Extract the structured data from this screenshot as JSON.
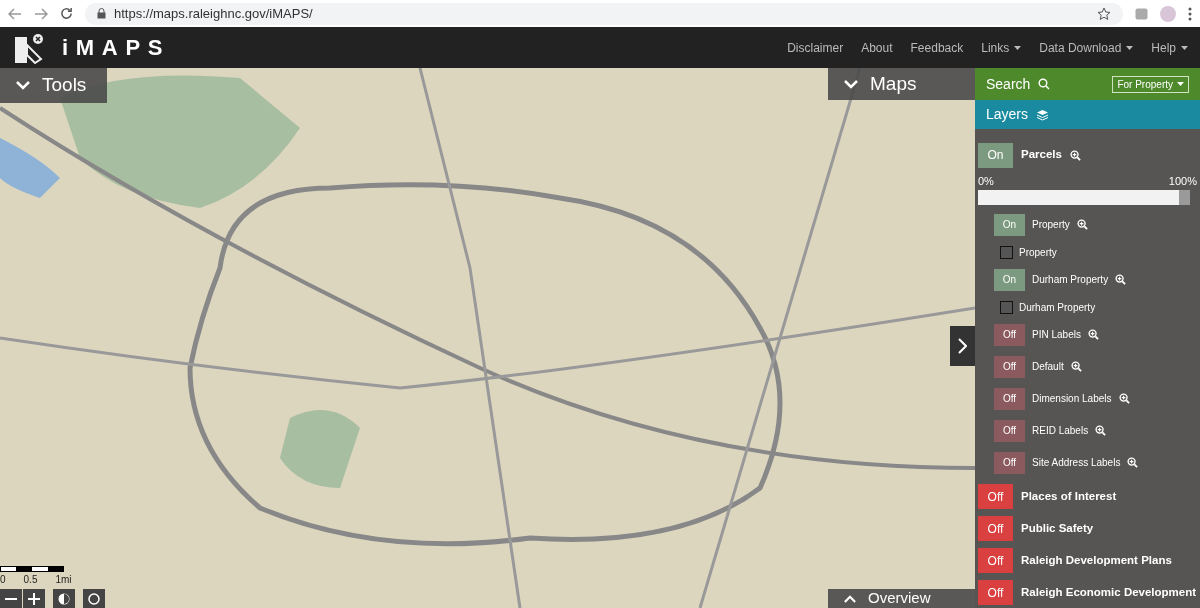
{
  "browser": {
    "url": "https://maps.raleighnc.gov/iMAPS/"
  },
  "app": {
    "title": "iMAPS",
    "nav": [
      {
        "label": "Disclaimer",
        "dropdown": false
      },
      {
        "label": "About",
        "dropdown": false
      },
      {
        "label": "Feedback",
        "dropdown": false
      },
      {
        "label": "Links",
        "dropdown": true
      },
      {
        "label": "Data Download",
        "dropdown": true
      },
      {
        "label": "Help",
        "dropdown": true
      }
    ]
  },
  "tools_panel": {
    "label": "Tools"
  },
  "maps_panel": {
    "label": "Maps"
  },
  "overview_panel": {
    "label": "Overview"
  },
  "search": {
    "label": "Search",
    "scope": "For Property"
  },
  "layers": {
    "label": "Layers",
    "groups": [
      {
        "label": "Parcels",
        "on": true,
        "toggle_text": "On",
        "zoom": true,
        "opacity": {
          "min_label": "0%",
          "max_label": "100%",
          "level": 0.95
        },
        "children": [
          {
            "kind": "toggle",
            "label": "Property",
            "on": true,
            "toggle_text": "On",
            "zoom": true
          },
          {
            "kind": "legend",
            "label": "Property"
          },
          {
            "kind": "toggle",
            "label": "Durham Property",
            "on": true,
            "toggle_text": "On",
            "zoom": true
          },
          {
            "kind": "legend",
            "label": "Durham Property"
          },
          {
            "kind": "toggle",
            "label": "PIN Labels",
            "on": false,
            "toggle_text": "Off",
            "zoom": true
          },
          {
            "kind": "toggle",
            "label": "Default",
            "on": false,
            "toggle_text": "Off",
            "zoom": true
          },
          {
            "kind": "toggle",
            "label": "Dimension Labels",
            "on": false,
            "toggle_text": "Off",
            "zoom": true
          },
          {
            "kind": "toggle",
            "label": "REID Labels",
            "on": false,
            "toggle_text": "Off",
            "zoom": true
          },
          {
            "kind": "toggle",
            "label": "Site Address Labels",
            "on": false,
            "toggle_text": "Off",
            "zoom": true
          }
        ]
      },
      {
        "label": "Places of Interest",
        "on": false,
        "toggle_text": "Off"
      },
      {
        "label": "Public Safety",
        "on": false,
        "toggle_text": "Off"
      },
      {
        "label": "Raleigh Development Plans",
        "on": false,
        "toggle_text": "Off"
      },
      {
        "label": "Raleigh Economic Development",
        "on": false,
        "toggle_text": "Off"
      }
    ]
  },
  "scale_bar": {
    "labels": [
      "0",
      "0.5",
      "1mi"
    ]
  }
}
